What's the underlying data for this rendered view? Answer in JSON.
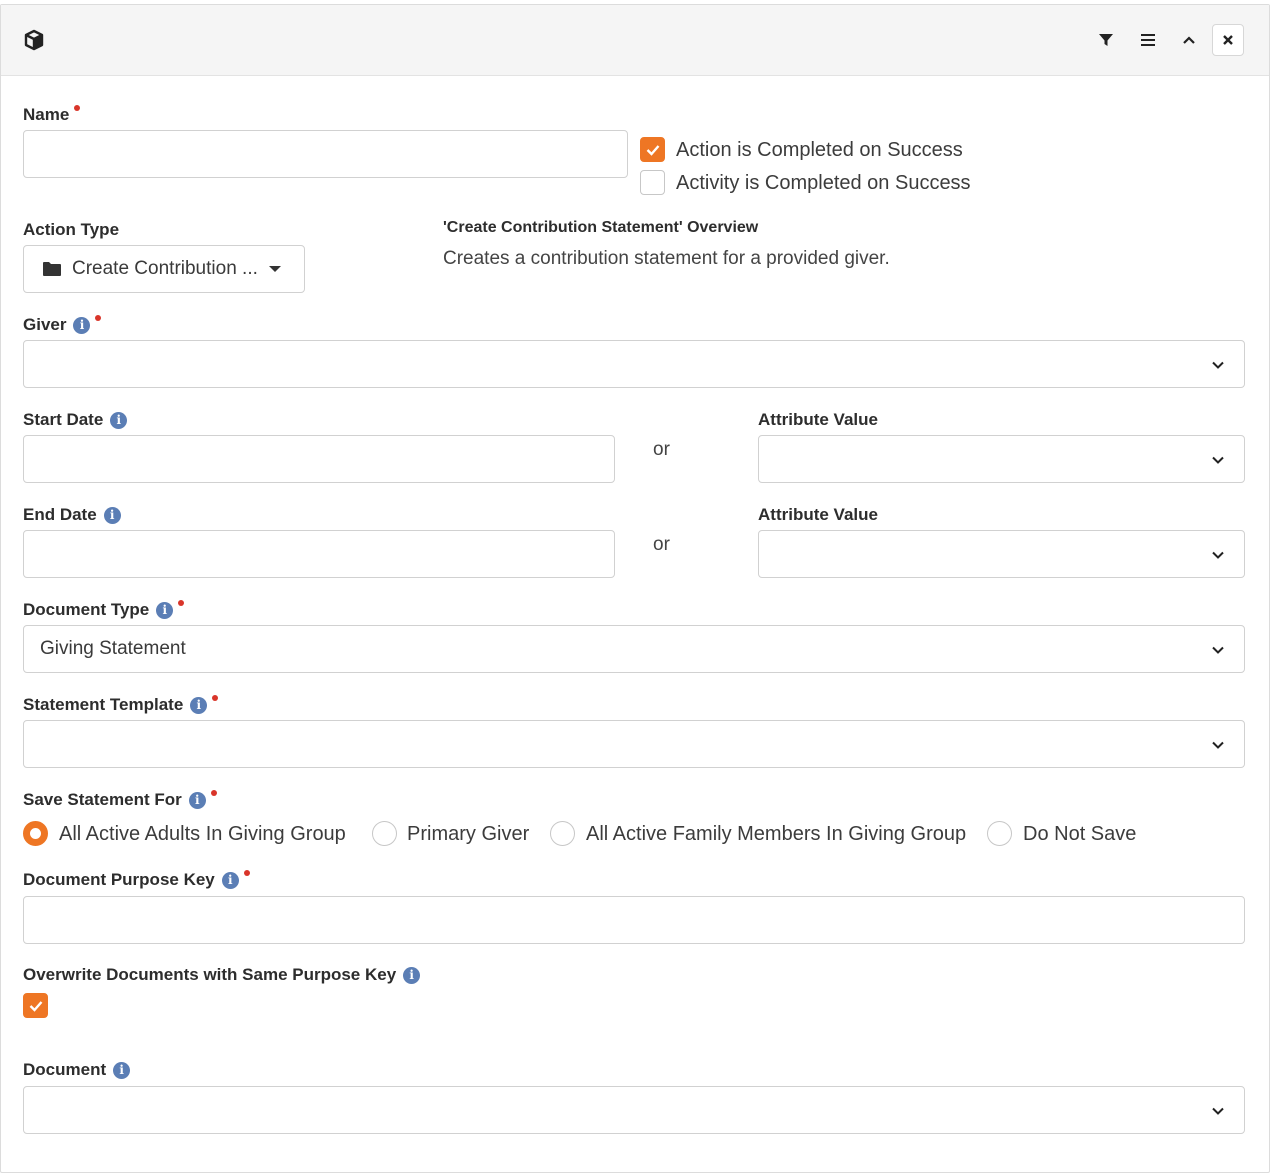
{
  "header": {
    "logo_icon": "cube-icon",
    "buttons": [
      {
        "name": "filter-icon"
      },
      {
        "name": "hamburger-menu-icon"
      },
      {
        "name": "chevron-up-icon"
      },
      {
        "name": "close-icon"
      }
    ]
  },
  "name": {
    "label": "Name",
    "value": ""
  },
  "checkboxes": {
    "action_completed": {
      "label": "Action is Completed on Success",
      "checked": true
    },
    "activity_completed": {
      "label": "Activity is Completed on Success",
      "checked": false
    }
  },
  "action_type": {
    "label": "Action Type",
    "value": "Create Contribution ...",
    "icon": "folder-icon"
  },
  "overview": {
    "title": "'Create Contribution Statement' Overview",
    "description": "Creates a contribution statement for a provided giver."
  },
  "giver": {
    "label": "Giver",
    "value": ""
  },
  "start_date": {
    "label": "Start Date",
    "value": "",
    "or_text": "or",
    "attr_label": "Attribute Value",
    "attr_value": ""
  },
  "end_date": {
    "label": "End Date",
    "value": "",
    "or_text": "or",
    "attr_label": "Attribute Value",
    "attr_value": ""
  },
  "document_type": {
    "label": "Document Type",
    "value": "Giving Statement"
  },
  "statement_template": {
    "label": "Statement Template",
    "value": ""
  },
  "save_statement_for": {
    "label": "Save Statement For",
    "options": [
      {
        "label": "All Active Adults In Giving Group",
        "selected": true
      },
      {
        "label": "Primary Giver",
        "selected": false
      },
      {
        "label": "All Active Family Members In Giving Group",
        "selected": false
      },
      {
        "label": "Do Not Save",
        "selected": false
      }
    ]
  },
  "document_purpose_key": {
    "label": "Document Purpose Key",
    "value": ""
  },
  "overwrite": {
    "label": "Overwrite Documents with Same Purpose Key",
    "checked": true
  },
  "document": {
    "label": "Document",
    "value": ""
  },
  "colors": {
    "accent": "#ee7624",
    "info": "#5b7eb5",
    "required": "#d9352a"
  }
}
